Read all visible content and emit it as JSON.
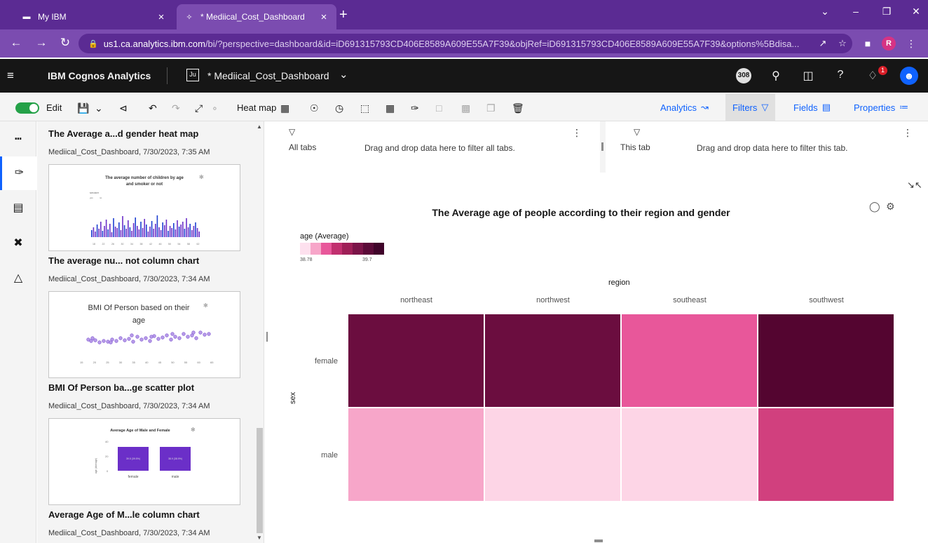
{
  "browser": {
    "tabs": [
      {
        "title": "My IBM",
        "icon": "ibm-logo-icon"
      },
      {
        "title": "* Mediical_Cost_Dashboard",
        "icon": "cognos-logo-icon"
      }
    ],
    "url_host": "us1.ca.analytics.ibm.com",
    "url_path": "/bi/?perspective=dashboard&id=iD691315793CD406E8589A609E55A7F39&objRef=iD691315793CD406E8589A609E55A7F39&options%5Bdisa...",
    "profile_initial": "R"
  },
  "header": {
    "brand": "IBM Cognos Analytics",
    "dashboard_title": "* Mediical_Cost_Dashboard",
    "counter": "308",
    "notification_count": "1"
  },
  "toolbar": {
    "edit_label": "Edit",
    "viz_type_label": "Heat map",
    "analytics_label": "Analytics",
    "filters_label": "Filters",
    "fields_label": "Fields",
    "properties_label": "Properties"
  },
  "panel": {
    "cards": [
      {
        "title": "The Average a...d gender heat map",
        "subtitle": "Mediical_Cost_Dashboard, 7/30/2023, 7:35 AM"
      },
      {
        "title": "The average nu... not column chart",
        "subtitle": "Mediical_Cost_Dashboard, 7/30/2023, 7:34 AM"
      },
      {
        "title": "BMI Of Person ba...ge scatter plot",
        "subtitle": "Mediical_Cost_Dashboard, 7/30/2023, 7:34 AM"
      },
      {
        "title": "Average Age of M...le column chart",
        "subtitle": "Mediical_Cost_Dashboard, 7/30/2023, 7:34 AM"
      }
    ],
    "thumbs": {
      "children": {
        "title_line1": "The average number of children by age",
        "title_line2": "and smoker or not",
        "legend_title": "smoker",
        "legend_items": [
          "yes",
          "no"
        ],
        "ticks": [
          "18",
          "22",
          "26",
          "30",
          "34",
          "38",
          "42",
          "46",
          "50",
          "54",
          "58",
          "62"
        ]
      },
      "bmi": {
        "title_line1": "BMI Of Person based on their",
        "title_line2": "age",
        "ticks": [
          "15",
          "20",
          "25",
          "30",
          "35",
          "40",
          "45",
          "50",
          "55",
          "60",
          "65"
        ]
      },
      "avg_age": {
        "title": "Average Age of Male and Female",
        "y_label": "age (Average)",
        "y_ticks": [
          "40",
          "20",
          "0"
        ],
        "bar_labels": [
          "39.5 (39.5%)",
          "38.9 (38.9%)"
        ],
        "categories": [
          "female",
          "male"
        ]
      }
    }
  },
  "filters": {
    "all_tabs_label": "All tabs",
    "all_tabs_hint": "Drag and drop data here to filter all tabs.",
    "this_tab_label": "This tab",
    "this_tab_hint": "Drag and drop data here to filter this tab."
  },
  "chart_data": {
    "type": "heatmap",
    "title": "The Average age of people according to their region and gender",
    "xlabel": "region",
    "ylabel": "sex",
    "legend_title": "age (Average)",
    "legend_min": "38.78",
    "legend_max": "39.7",
    "x_categories": [
      "northeast",
      "northwest",
      "southeast",
      "southwest"
    ],
    "y_categories": [
      "female",
      "male"
    ],
    "values": [
      [
        39.5,
        39.5,
        39.2,
        39.7
      ],
      [
        39.1,
        38.9,
        38.9,
        39.3
      ]
    ],
    "colors": [
      [
        "#6b0d3f",
        "#6b0d3f",
        "#e8579a",
        "#540530"
      ],
      [
        "#f7a6c9",
        "#fdd5e6",
        "#fdd5e6",
        "#d1407e"
      ]
    ],
    "legend_colors": [
      "#fde0ee",
      "#f7a6c9",
      "#e8579a",
      "#c1306f",
      "#9e1f57",
      "#7b1448",
      "#5b0a38",
      "#40042a"
    ]
  }
}
